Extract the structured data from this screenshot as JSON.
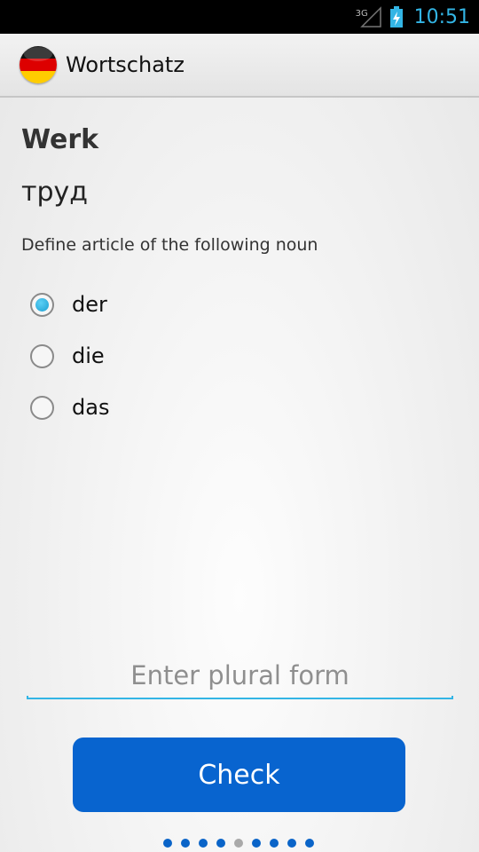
{
  "status_bar": {
    "network": "3G",
    "time": "10:51"
  },
  "action_bar": {
    "title": "Wortschatz",
    "icon": "germany-flag-icon"
  },
  "card": {
    "word": "Werk",
    "translation": "труд",
    "prompt": "Define article of the following noun",
    "articles": [
      {
        "label": "der",
        "checked": true
      },
      {
        "label": "die",
        "checked": false
      },
      {
        "label": "das",
        "checked": false
      }
    ],
    "plural_placeholder": "Enter plural form",
    "check_label": "Check"
  },
  "pager": {
    "count": 9,
    "current": 5
  },
  "colors": {
    "accent": "#33b5e5",
    "button": "#0864cf",
    "dot": "#0a64c8",
    "dot_active": "#a9a9a9"
  }
}
